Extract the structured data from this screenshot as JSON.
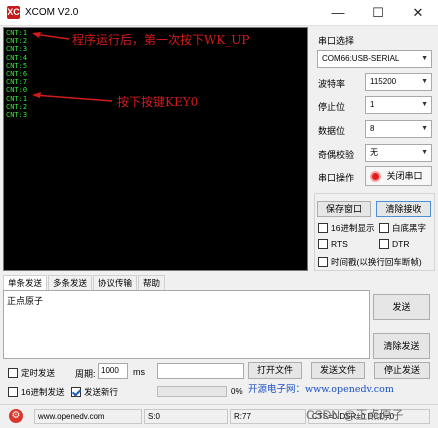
{
  "window": {
    "title": "XCOM V2.0",
    "logo_text": "XC",
    "btn_min": "—",
    "btn_max": "☐",
    "btn_close": "✕"
  },
  "terminal": {
    "lines": [
      "CNT:1",
      "CNT:2",
      "CNT:3",
      "CNT:4",
      "CNT:5",
      "CNT:6",
      "CNT:7",
      "CNT:0",
      "CNT:1",
      "CNT:2",
      "CNT:3"
    ],
    "annotation_1": "程序运行后，第一次按下WK_UP",
    "annotation_2": "按下按键KEY0"
  },
  "settings": {
    "port_label": "串口选择",
    "port_value": "COM66:USB-SERIAL",
    "baud_label": "波特率",
    "baud_value": "115200",
    "stop_label": "停止位",
    "stop_value": "1",
    "data_label": "数据位",
    "data_value": "8",
    "parity_label": "奇偶校验",
    "parity_value": "无",
    "op_label": "串口操作",
    "op_button": "关闭串口"
  },
  "receive": {
    "save_window": "保存窗口",
    "clear_receive": "清除接收",
    "hex_display": "16进制显示",
    "white_bg_black_text": "白底黑字",
    "rts": "RTS",
    "dtr": "DTR",
    "timestamp": "时间戳(以换行回车断帧)"
  },
  "tabs": [
    "单条发送",
    "多条发送",
    "协议传输",
    "帮助"
  ],
  "send": {
    "text": "正点原子",
    "send_button": "发送",
    "clear_send": "清除发送",
    "timed_send": "定时发送",
    "period_label": "周期:",
    "period_value": "1000",
    "period_unit": "ms",
    "open_file": "打开文件",
    "send_file": "发送文件",
    "stop_send": "停止发送",
    "hex_send": "16进制发送",
    "send_newline": "发送新行",
    "progress_text": "0%",
    "progress": 0
  },
  "ad_text": "开源电子网：www.openedv.com",
  "status": {
    "gear": "⚙",
    "url": "www.openedv.com",
    "s": "S:0",
    "r": "R:77",
    "cts": "CTS=0 DSR=0 DCD=0"
  },
  "watermark": "CSDN @正点原子"
}
